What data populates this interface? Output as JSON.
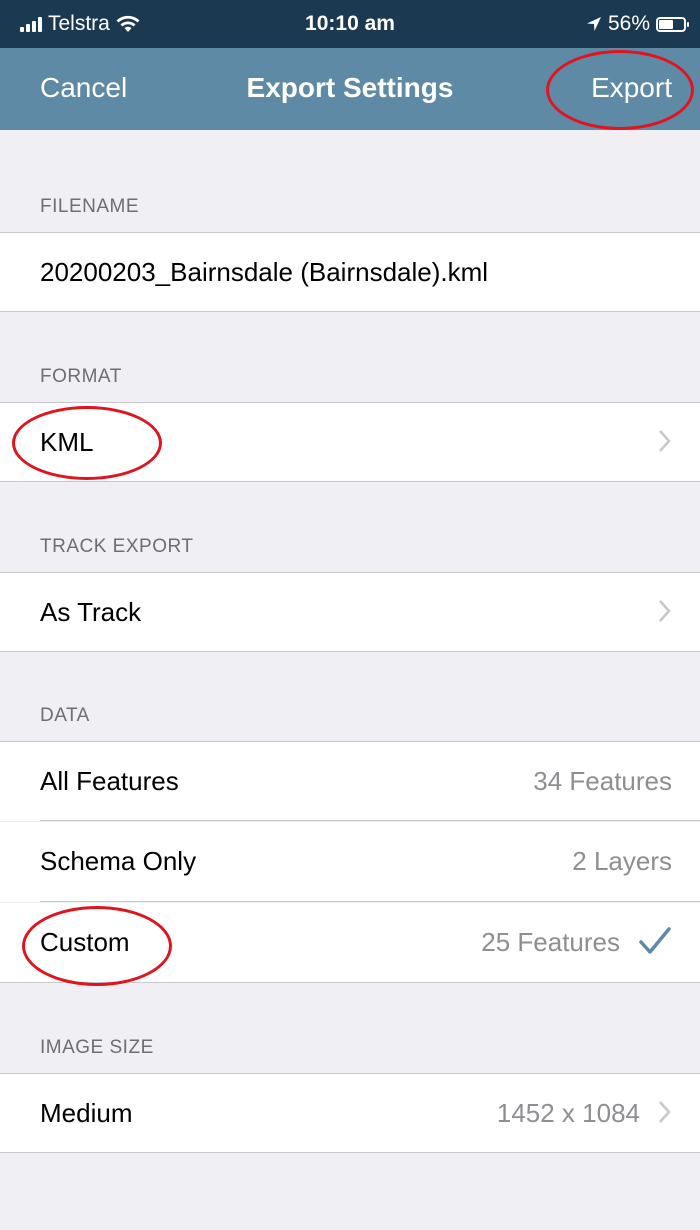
{
  "status_bar": {
    "carrier": "Telstra",
    "time": "10:10 am",
    "battery": "56%",
    "battery_level": 0.56
  },
  "nav": {
    "cancel_label": "Cancel",
    "title": "Export Settings",
    "export_label": "Export"
  },
  "sections": {
    "filename": {
      "header": "FILENAME",
      "value": "20200203_Bairnsdale (Bairnsdale).kml"
    },
    "format": {
      "header": "FORMAT",
      "value": "KML"
    },
    "track_export": {
      "header": "TRACK EXPORT",
      "value": "As Track"
    },
    "data": {
      "header": "DATA",
      "items": [
        {
          "label": "All Features",
          "detail": "34 Features",
          "selected": false
        },
        {
          "label": "Schema Only",
          "detail": "2 Layers",
          "selected": false
        },
        {
          "label": "Custom",
          "detail": "25 Features",
          "selected": true
        }
      ]
    },
    "image_size": {
      "header": "IMAGE SIZE",
      "label": "Medium",
      "detail": "1452 x 1084"
    }
  },
  "icons": {
    "chevron": "chevron-right-icon",
    "check": "checkmark-icon",
    "wifi": "wifi-icon",
    "location": "location-arrow-icon"
  },
  "colors": {
    "status_bar": "#1b3a52",
    "nav_bar": "#5e8aa6",
    "accent_check": "#5e8aa6",
    "annotation": "#e0141e"
  }
}
